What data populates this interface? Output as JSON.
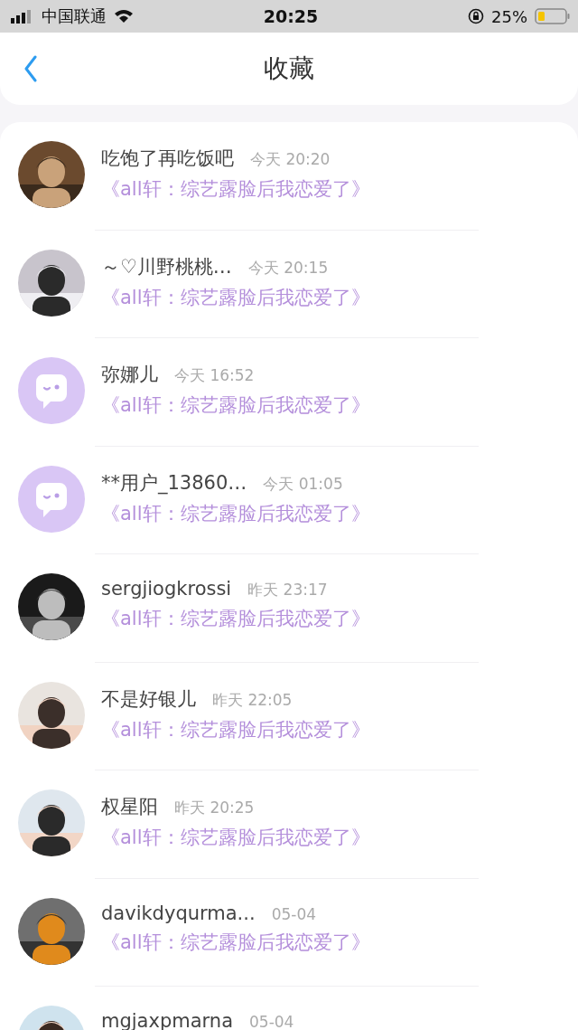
{
  "status_bar": {
    "carrier": "中国联通",
    "time": "20:25",
    "battery": "25%"
  },
  "header": {
    "title": "收藏"
  },
  "items": [
    {
      "name": "吃饱了再吃饭吧",
      "time": "今天 20:20",
      "title": "《all轩：综艺露脸后我恋爱了》"
    },
    {
      "name": "～♡川野桃桃…",
      "time": "今天 20:15",
      "title": "《all轩：综艺露脸后我恋爱了》"
    },
    {
      "avatar": {
        "kind": "default"
      },
      "name": "弥娜儿",
      "time": "今天 16:52",
      "title": "《all轩：综艺露脸后我恋爱了》"
    },
    {
      "avatar": {
        "kind": "default"
      },
      "name": "**用户_13860…",
      "time": "今天 01:05",
      "title": "《all轩：综艺露脸后我恋爱了》"
    },
    {
      "name": "sergjiogkrossi",
      "time": "昨天 23:17",
      "title": "《all轩：综艺露脸后我恋爱了》"
    },
    {
      "name": "不是好银儿",
      "time": "昨天 22:05",
      "title": "《all轩：综艺露脸后我恋爱了》"
    },
    {
      "name": "权星阳",
      "time": "昨天 20:25",
      "title": "《all轩：综艺露脸后我恋爱了》"
    },
    {
      "name": "davikdyqurma...",
      "time": "05-04",
      "title": "《all轩：综艺露脸后我恋爱了》"
    },
    {
      "name": "mgjaxpmarna",
      "time": "05-04"
    }
  ]
}
